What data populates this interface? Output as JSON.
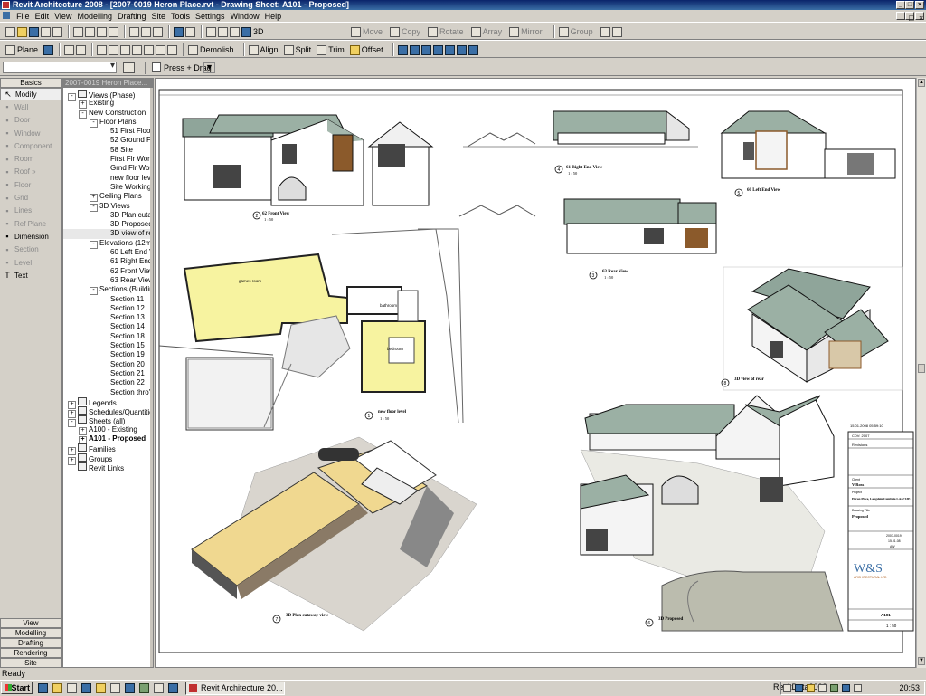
{
  "window": {
    "title": "Revit Architecture 2008 - [2007-0019 Heron Place.rvt - Drawing Sheet: A101 - Proposed]"
  },
  "menu": [
    "File",
    "Edit",
    "View",
    "Modelling",
    "Drafting",
    "Site",
    "Tools",
    "Settings",
    "Window",
    "Help"
  ],
  "toolbar1": {
    "view3d": "3D",
    "move": "Move",
    "copy": "Copy",
    "rotate": "Rotate",
    "array": "Array",
    "mirror": "Mirror",
    "group": "Group"
  },
  "toolbar2": {
    "plane": "Plane",
    "demolish": "Demolish",
    "align": "Align",
    "split": "Split",
    "trim": "Trim",
    "offset": "Offset"
  },
  "options": {
    "press_drag": "Press + Drag"
  },
  "design_bar": {
    "tab": "Basics",
    "items": [
      {
        "label": "Modify",
        "icon": "arrow-pointer-icon",
        "enabled": true
      },
      {
        "label": "Wall",
        "icon": "wall-icon",
        "enabled": false
      },
      {
        "label": "Door",
        "icon": "door-icon",
        "enabled": false
      },
      {
        "label": "Window",
        "icon": "window-icon",
        "enabled": false
      },
      {
        "label": "Component",
        "icon": "component-icon",
        "enabled": false
      },
      {
        "label": "Room",
        "icon": "room-icon",
        "enabled": false
      },
      {
        "label": "Roof »",
        "icon": "roof-icon",
        "enabled": false
      },
      {
        "label": "Floor",
        "icon": "floor-icon",
        "enabled": false
      },
      {
        "label": "Grid",
        "icon": "grid-icon",
        "enabled": false
      },
      {
        "label": "Lines",
        "icon": "lines-icon",
        "enabled": false
      },
      {
        "label": "Ref Plane",
        "icon": "ref-plane-icon",
        "enabled": false
      },
      {
        "label": "Dimension",
        "icon": "dimension-icon",
        "enabled": true
      },
      {
        "label": "Section",
        "icon": "section-icon",
        "enabled": false
      },
      {
        "label": "Level",
        "icon": "level-icon",
        "enabled": false
      },
      {
        "label": "Text",
        "icon": "text-icon",
        "enabled": true
      }
    ],
    "bottom_tabs": [
      "View",
      "Modelling",
      "Drafting",
      "Rendering",
      "Site"
    ]
  },
  "project_browser": {
    "title": "2007-0019 Heron Place...",
    "nodes": [
      {
        "label": "Views (Phase)",
        "level": 0,
        "pm": "-",
        "icon": true
      },
      {
        "label": "Existing",
        "level": 1,
        "pm": "+"
      },
      {
        "label": "New Construction",
        "level": 1,
        "pm": "-"
      },
      {
        "label": "Floor Plans",
        "level": 2,
        "pm": "-"
      },
      {
        "label": "51 First Floor",
        "level": 3
      },
      {
        "label": "52 Ground Flo",
        "level": 3
      },
      {
        "label": "58 Site",
        "level": 3
      },
      {
        "label": "First Flr Work",
        "level": 3
      },
      {
        "label": "Grnd Flr Work",
        "level": 3
      },
      {
        "label": "new floor leve",
        "level": 3
      },
      {
        "label": "Site Working",
        "level": 3
      },
      {
        "label": "Ceiling Plans",
        "level": 2,
        "pm": "+"
      },
      {
        "label": "3D Views",
        "level": 2,
        "pm": "-"
      },
      {
        "label": "3D Plan cutav",
        "level": 3
      },
      {
        "label": "3D Proposed",
        "level": 3
      },
      {
        "label": "3D view of rea",
        "level": 3,
        "selected": true
      },
      {
        "label": "Elevations (12mm",
        "level": 2,
        "pm": "-"
      },
      {
        "label": "60 Left End V",
        "level": 3
      },
      {
        "label": "61 Right End",
        "level": 3
      },
      {
        "label": "62 Front View",
        "level": 3
      },
      {
        "label": "63 Rear View",
        "level": 3
      },
      {
        "label": "Sections (Building",
        "level": 2,
        "pm": "-"
      },
      {
        "label": "Section 11",
        "level": 3
      },
      {
        "label": "Section 12",
        "level": 3
      },
      {
        "label": "Section 13",
        "level": 3
      },
      {
        "label": "Section 14",
        "level": 3
      },
      {
        "label": "Section 18",
        "level": 3
      },
      {
        "label": "Section 15",
        "level": 3
      },
      {
        "label": "Section 19",
        "level": 3
      },
      {
        "label": "Section 20",
        "level": 3
      },
      {
        "label": "Section 21",
        "level": 3
      },
      {
        "label": "Section 22",
        "level": 3
      },
      {
        "label": "Section thro' f",
        "level": 3
      },
      {
        "label": "Legends",
        "level": 0,
        "pm": "+",
        "icon": true
      },
      {
        "label": "Schedules/Quantities",
        "level": 0,
        "pm": "+",
        "icon": true
      },
      {
        "label": "Sheets (all)",
        "level": 0,
        "pm": "-",
        "icon": true
      },
      {
        "label": "A100 - Existing",
        "level": 1,
        "pm": "+"
      },
      {
        "label": "A101 - Proposed",
        "level": 1,
        "pm": "+",
        "bold": true
      },
      {
        "label": "Families",
        "level": 0,
        "pm": "+",
        "icon": true
      },
      {
        "label": "Groups",
        "level": 0,
        "pm": "+",
        "icon": true
      },
      {
        "label": "Revit Links",
        "level": 0,
        "icon": true
      }
    ]
  },
  "sheet": {
    "views": [
      {
        "num": "2",
        "title": "62 Front View",
        "scale": "1 : 50"
      },
      {
        "num": "4",
        "title": "61 Right End View",
        "scale": "1 : 50"
      },
      {
        "num": "5",
        "title": "60 Left End View",
        "scale": "1 : 50"
      },
      {
        "num": "3",
        "title": "63 Rear View",
        "scale": "1 : 50"
      },
      {
        "num": "1",
        "title": "new floor level",
        "scale": "1 : 50"
      },
      {
        "num": "8",
        "title": "3D view of rear",
        "scale": ""
      },
      {
        "num": "7",
        "title": "3D Plan cutaway view",
        "scale": ""
      },
      {
        "num": "6",
        "title": "3D Proposed",
        "scale": ""
      }
    ],
    "plan_labels": {
      "games": "games room",
      "bathroom": "bathroom",
      "bedroom": "bedroom"
    },
    "titleblock": {
      "date_time": "15.01.2008 05:59:10",
      "cdv": "CDV: 2007",
      "revisions": "Revisions",
      "client_label": "Client",
      "client": "V Ross",
      "project_label": "Project",
      "project": "Heron Place, Langdale Cumbria LA22 9JE",
      "drawing_title_label": "Drawing Title",
      "drawing_title": "Proposed",
      "project_no": "2007-0019",
      "date_issued": "15.01.08",
      "drawn_by": "AW",
      "firm": "W&S",
      "firm_sub": "ARCHITECTURAL LTD",
      "drg_no": "A101",
      "scale": "1 : 50"
    }
  },
  "status": {
    "text": "Ready"
  },
  "taskbar": {
    "start": "Start",
    "task": "Revit Architecture 20...",
    "tray_label": "RevitData2008",
    "clock": "20:53"
  }
}
